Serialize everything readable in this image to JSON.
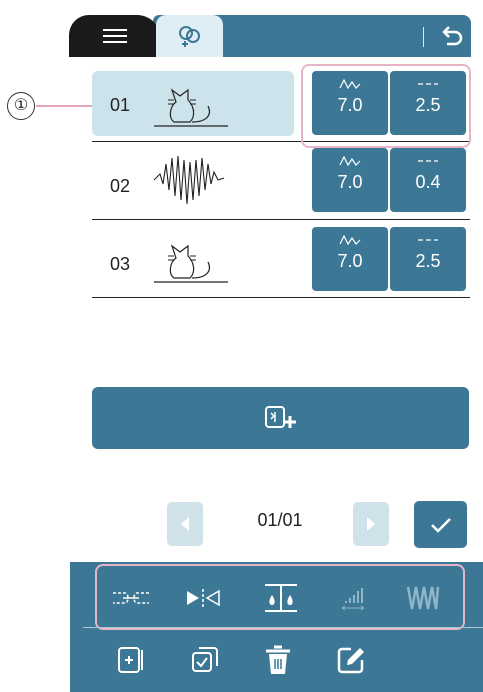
{
  "header": {
    "menu_icon": "hamburger-icon",
    "active_tab_icon": "linked-patterns-icon",
    "back_icon": "undo-icon"
  },
  "callout": {
    "label": "①"
  },
  "rows": [
    {
      "number": "01",
      "preview_icon": "cat-outline-icon",
      "width_value": "7.0",
      "length_value": "2.5",
      "selected": true
    },
    {
      "number": "02",
      "preview_icon": "zigzag-heart-icon",
      "width_value": "7.0",
      "length_value": "0.4",
      "selected": false
    },
    {
      "number": "03",
      "preview_icon": "cat-outline-icon",
      "width_value": "7.0",
      "length_value": "2.5",
      "selected": false
    }
  ],
  "add_button": {
    "icon": "add-pattern-icon"
  },
  "pager": {
    "text": "01/01",
    "prev_icon": "left-arrow-icon",
    "next_icon": "right-arrow-icon",
    "confirm_icon": "check-icon"
  },
  "toolbar_row1": [
    "chain-icon",
    "mirror-flip-icon",
    "density-icon",
    "size-bars-icon",
    "triple-stitch-icon"
  ],
  "toolbar_row2": [
    "insert-icon",
    "duplicate-icon",
    "delete-icon",
    "edit-icon"
  ],
  "colors": {
    "accent": "#3c7895",
    "light": "#cfe2ea",
    "highlight": "#e6b5c8"
  }
}
